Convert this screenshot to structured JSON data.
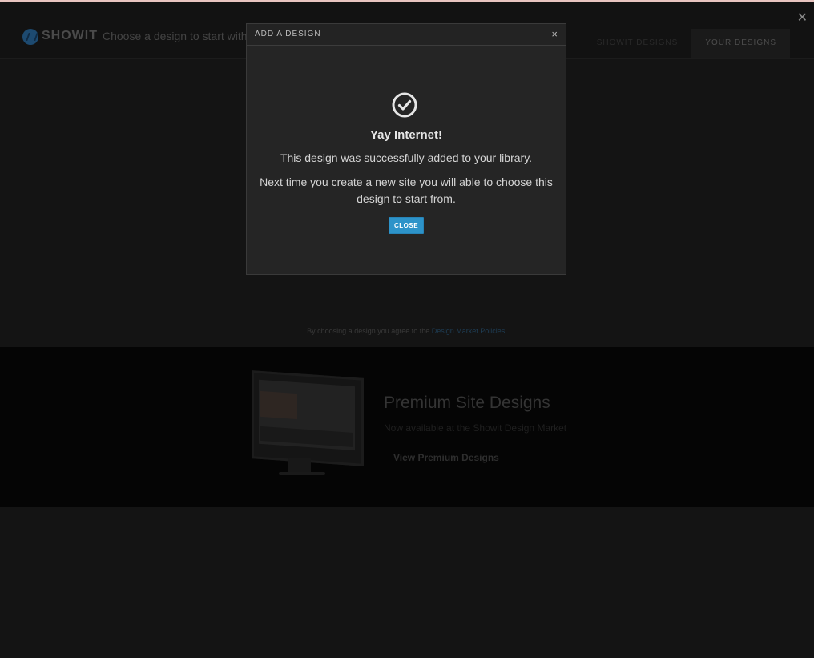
{
  "header": {
    "brand": "SHOWIT",
    "subtitle": "Choose a design to start with",
    "tabs": [
      {
        "label": "SHOWIT DESIGNS",
        "active": false
      },
      {
        "label": "YOUR DESIGNS",
        "active": true
      }
    ],
    "close_icon": "close-icon"
  },
  "modal": {
    "title": "ADD A DESIGN",
    "close_glyph": "×",
    "icon": "check-circle-icon",
    "heading": "Yay Internet!",
    "line1": "This design was successfully added to your library.",
    "line2": "Next time you create a new site you will able to choose this design to start from.",
    "button_label": "CLOSE",
    "button_color": "#2d93c9"
  },
  "agreement": {
    "text": "By choosing a design you agree to the ",
    "link_text": "Design Market Policies",
    "suffix": "."
  },
  "premium": {
    "title": "Premium Site Designs",
    "subtitle": "Now available at the Showit Design Market",
    "link_label": "View Premium Designs"
  }
}
